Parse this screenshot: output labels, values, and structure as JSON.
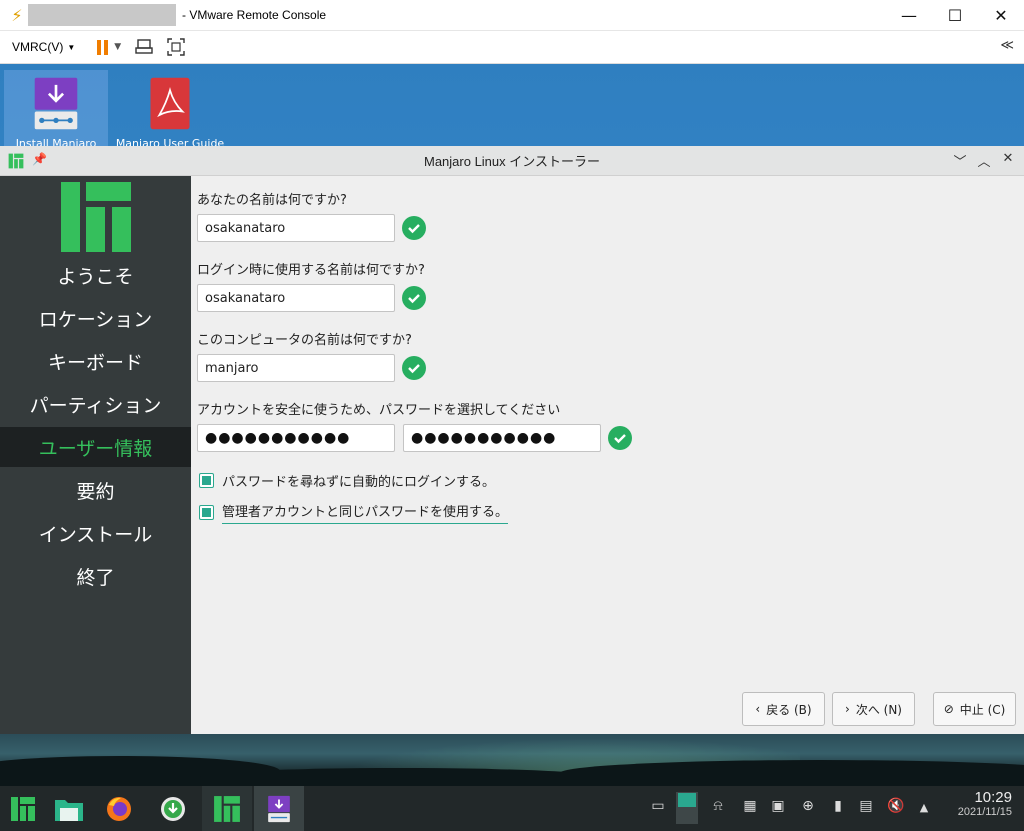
{
  "vmrc": {
    "title": "- VMware Remote Console",
    "menu_label": "VMRC(V)",
    "collapse_label": "≪"
  },
  "desktop": {
    "icons": [
      {
        "label": "Install Manjaro",
        "icon": "installer-icon"
      },
      {
        "label": "Manjaro User Guide",
        "icon": "pdf-icon"
      }
    ]
  },
  "installer": {
    "title": "Manjaro Linux インストーラー",
    "sidebar": [
      {
        "label": "ようこそ"
      },
      {
        "label": "ロケーション"
      },
      {
        "label": "キーボード"
      },
      {
        "label": "パーティション"
      },
      {
        "label": "ユーザー情報",
        "active": true
      },
      {
        "label": "要約"
      },
      {
        "label": "インストール"
      },
      {
        "label": "終了"
      }
    ],
    "form": {
      "name_label": "あなたの名前は何ですか?",
      "name_value": "osakanataro",
      "login_label": "ログイン時に使用する名前は何ですか?",
      "login_value": "osakanataro",
      "host_label": "このコンピュータの名前は何ですか?",
      "host_value": "manjaro",
      "password_label": "アカウントを安全に使うため、パスワードを選択してください",
      "password_value": "●●●●●●●●●●●",
      "password_confirm_value": "●●●●●●●●●●●",
      "autologin_label": "パスワードを尋ねずに自動的にログインする。",
      "autologin_checked": true,
      "admin_pw_label": "管理者アカウントと同じパスワードを使用する。",
      "admin_pw_checked": true
    },
    "buttons": {
      "back": "戻る (B)",
      "next": "次へ (N)",
      "cancel": "中止 (C)"
    }
  },
  "taskbar": {
    "time": "10:29",
    "date": "2021/11/15"
  },
  "colors": {
    "accent": "#35bf5c",
    "ok": "#27ae60",
    "manjaro": "#35bf5c",
    "sidebar": "#353b3c"
  }
}
